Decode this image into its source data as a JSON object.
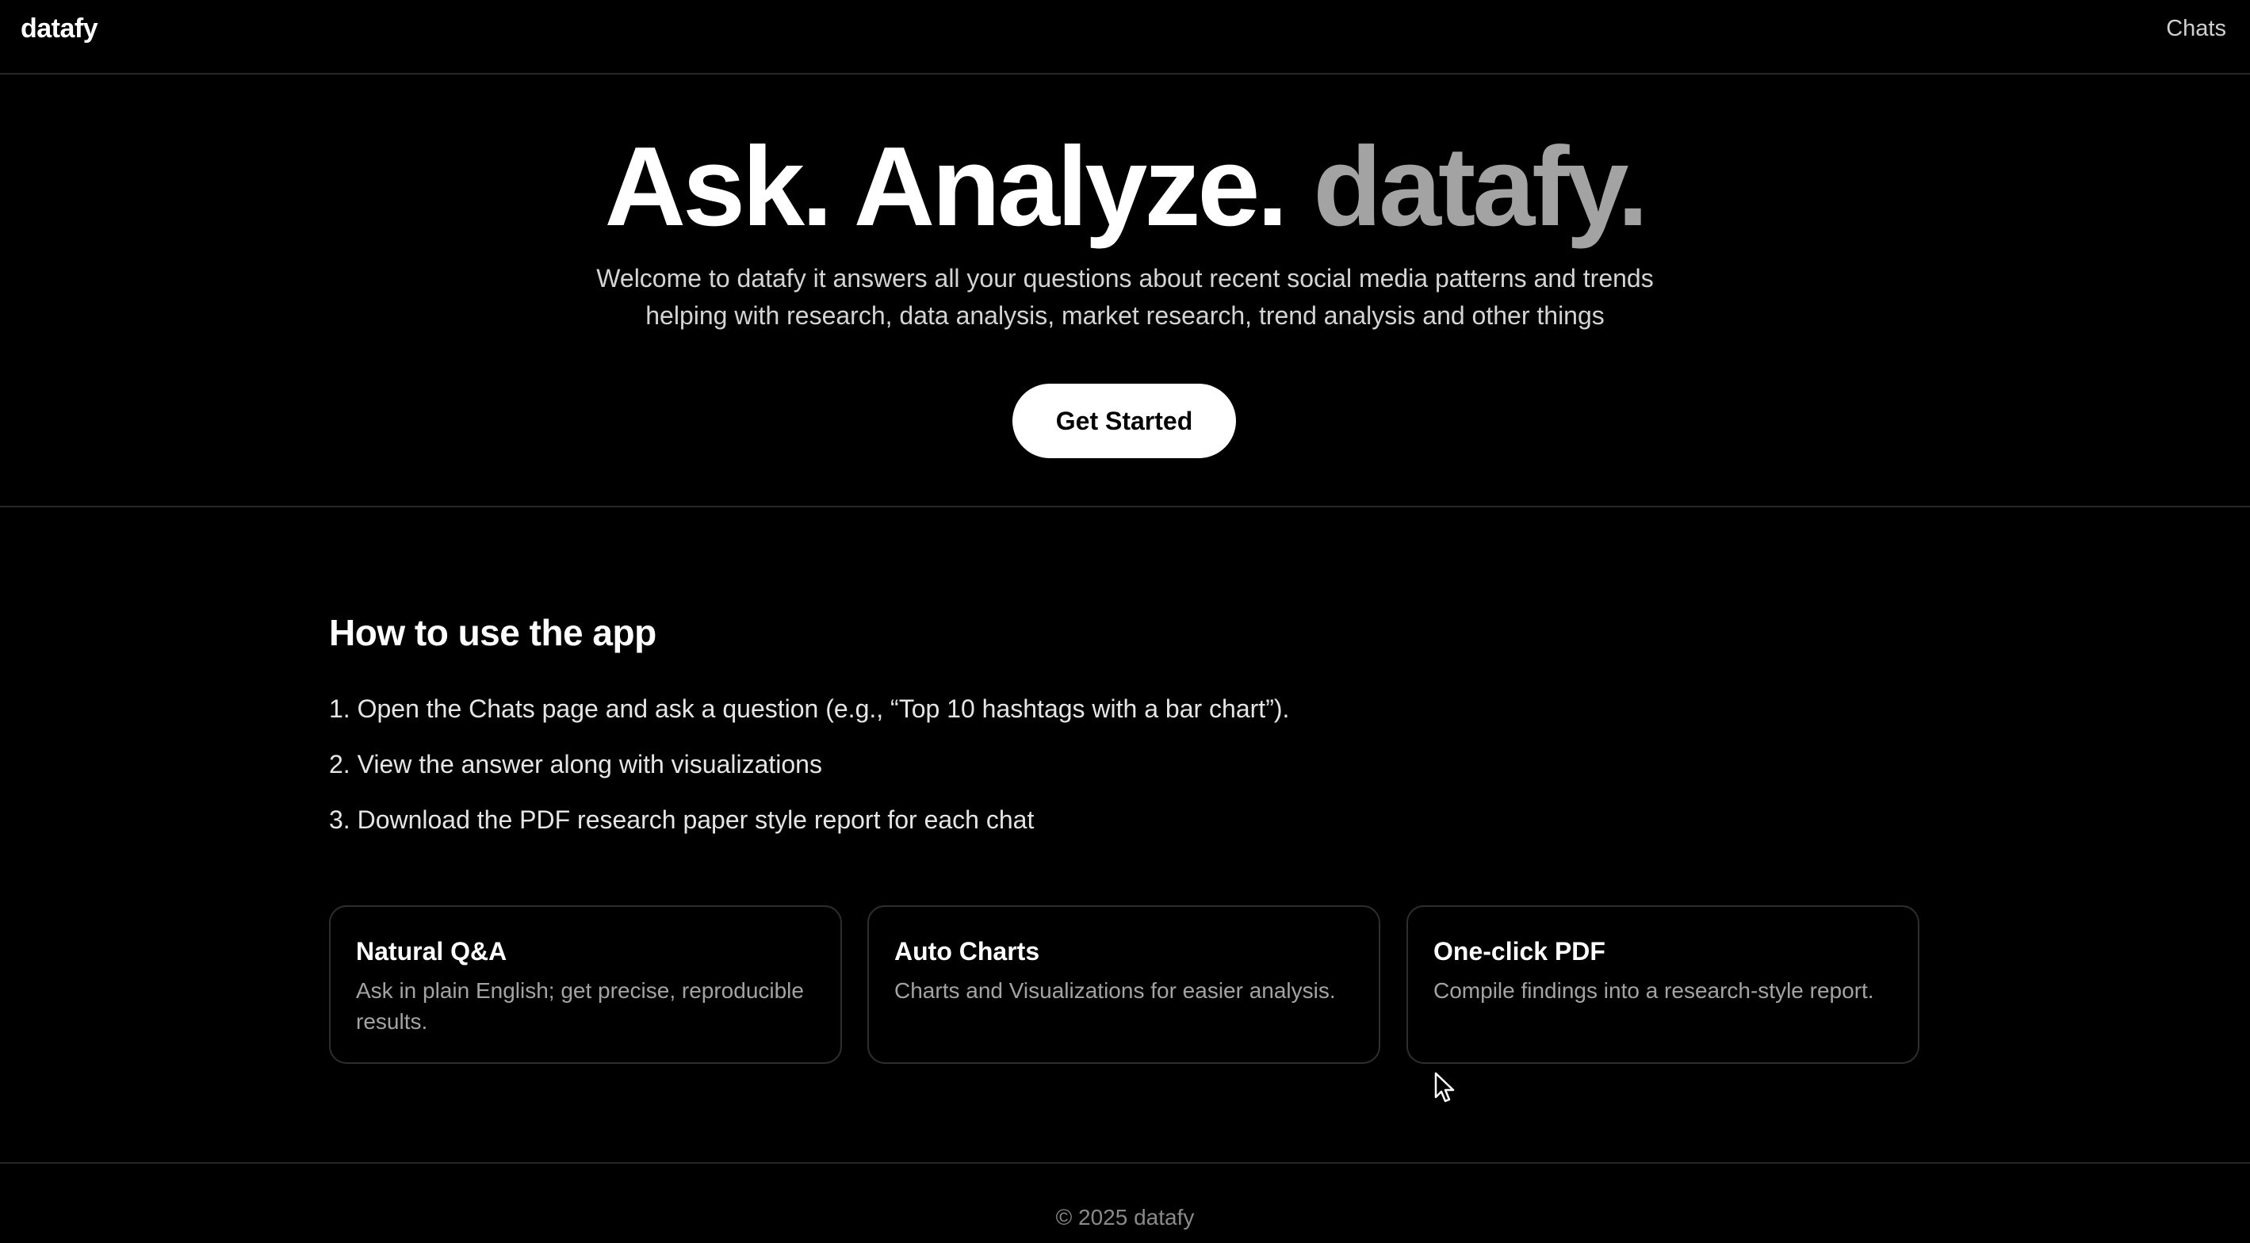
{
  "header": {
    "brand": "datafy",
    "nav_chats": "Chats"
  },
  "hero": {
    "title_part1": "Ask. Analyze.",
    "title_part2": "datafy.",
    "subtitle": "Welcome to datafy it answers all your questions about recent social media patterns and trends helping with research, data analysis, market research, trend analysis and other things",
    "cta_label": "Get Started"
  },
  "howto": {
    "title": "How to use the app",
    "steps": [
      "1. Open the Chats page and ask a question (e.g., “Top 10 hashtags with a bar chart”).",
      "2. View the answer along with visualizations",
      "3. Download the PDF research paper style report for each chat"
    ],
    "cards": [
      {
        "title": "Natural Q&A",
        "desc": "Ask in plain English; get precise, reproducible results."
      },
      {
        "title": "Auto Charts",
        "desc": "Charts and Visualizations for easier analysis."
      },
      {
        "title": "One-click PDF",
        "desc": "Compile findings into a research-style report."
      }
    ]
  },
  "footer": {
    "copyright": "© 2025 datafy"
  },
  "colors": {
    "background": "#000000",
    "text": "#ffffff",
    "muted": "#a3a3a3",
    "border": "#262626",
    "cta_bg": "#ffffff",
    "cta_text": "#000000"
  },
  "icons": {
    "cursor": "mouse-pointer-icon"
  }
}
